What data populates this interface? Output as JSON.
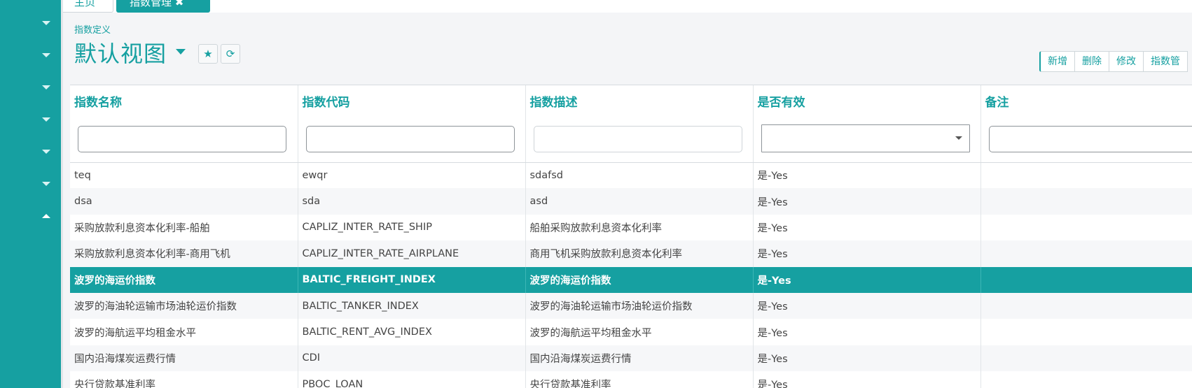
{
  "sidebar": {
    "expand_icons": [
      "chevron-down-icon",
      "chevron-down-icon",
      "chevron-down-icon",
      "chevron-down-icon",
      "chevron-down-icon",
      "chevron-down-icon",
      "chevron-up-icon"
    ]
  },
  "tabs": {
    "home": "主页",
    "active": "指数管理 ✖"
  },
  "header": {
    "breadcrumb": "指数定义",
    "title": "默认视图",
    "star_icon": "★",
    "refresh_icon": "⟳"
  },
  "toolbar": {
    "buttons": [
      "新增",
      "删除",
      "修改",
      "指数管"
    ]
  },
  "grid": {
    "columns": [
      "指数名称",
      "指数代码",
      "指数描述",
      "是否有效",
      "备注"
    ],
    "rows": [
      [
        "teq",
        "ewqr",
        "sdafsd",
        "是-Yes",
        ""
      ],
      [
        "dsa",
        "sda",
        "asd",
        "是-Yes",
        ""
      ],
      [
        "采购放款利息资本化利率-船舶",
        "CAPLIZ_INTER_RATE_SHIP",
        "船舶采购放款利息资本化利率",
        "是-Yes",
        ""
      ],
      [
        "采购放款利息资本化利率-商用飞机",
        "CAPLIZ_INTER_RATE_AIRPLANE",
        "商用飞机采购放款利息资本化利率",
        "是-Yes",
        ""
      ],
      [
        "波罗的海运价指数",
        "BALTIC_FREIGHT_INDEX",
        "波罗的海运价指数",
        "是-Yes",
        ""
      ],
      [
        "波罗的海油轮运输市场油轮运价指数",
        "BALTIC_TANKER_INDEX",
        "波罗的海油轮运输市场油轮运价指数",
        "是-Yes",
        ""
      ],
      [
        "波罗的海航运平均租金水平",
        "BALTIC_RENT_AVG_INDEX",
        "波罗的海航运平均租金水平",
        "是-Yes",
        ""
      ],
      [
        "国内沿海煤炭运费行情",
        "CDI",
        "国内沿海煤炭运费行情",
        "是-Yes",
        ""
      ],
      [
        "央行贷款基准利率",
        "PBOC_LOAN",
        "央行贷款基准利率",
        "是-Yes",
        ""
      ]
    ],
    "selected_row_index": 4
  },
  "colors": {
    "accent": "#16a0a1",
    "background": "#f4f5f7"
  }
}
